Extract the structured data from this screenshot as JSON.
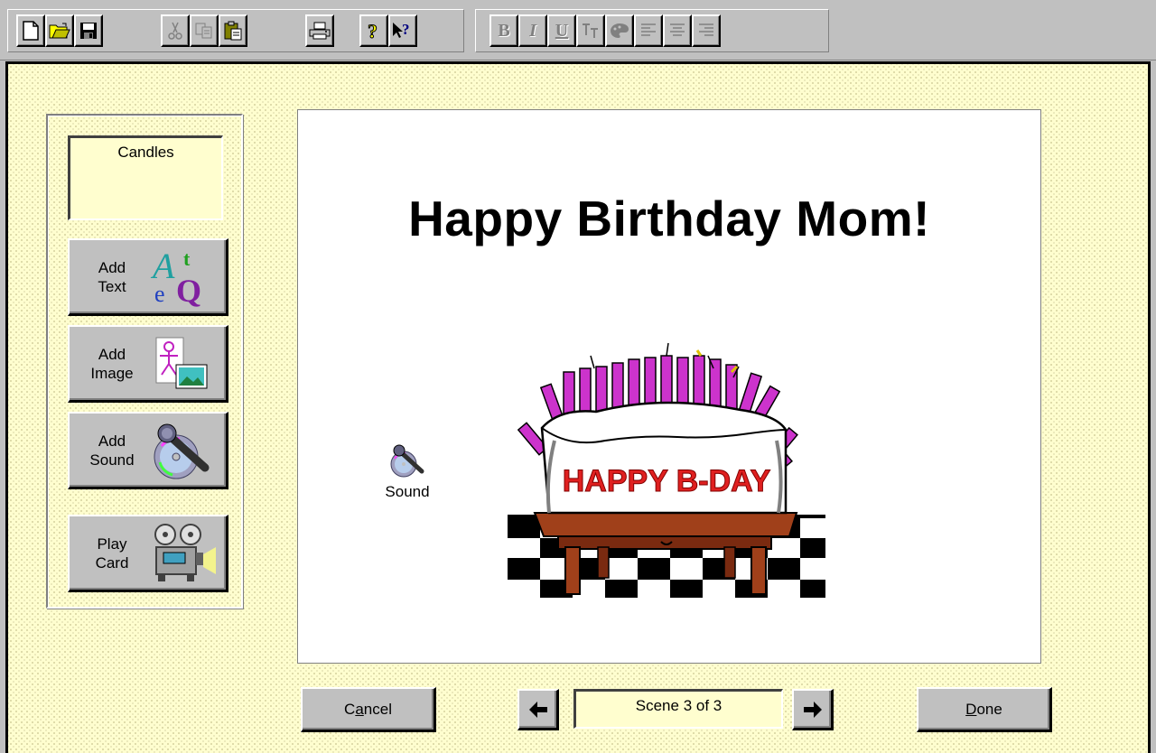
{
  "toolbar": {
    "file_buttons": [
      "new-document-icon",
      "open-folder-icon",
      "save-disk-icon"
    ],
    "edit_buttons": [
      "cut-scissors-icon",
      "copy-icon",
      "paste-icon"
    ],
    "print_button": "printer-icon",
    "help_buttons": [
      "help-question-icon",
      "context-help-icon"
    ],
    "format": {
      "bold": "B",
      "italic": "I",
      "underline": "U"
    }
  },
  "sidebar": {
    "scene_name": "Candles",
    "add_text": {
      "line1": "Add",
      "line2": "Text"
    },
    "add_image": {
      "line1": "Add",
      "line2": "Image"
    },
    "add_sound": {
      "line1": "Add",
      "line2": "Sound"
    },
    "play_card": {
      "line1": "Play",
      "line2": "Card"
    }
  },
  "card": {
    "title": "Happy Birthday Mom!",
    "sound_label": "Sound",
    "banner_text": "HAPPY B-DAY"
  },
  "footer": {
    "cancel_pre": "C",
    "cancel_ul": "a",
    "cancel_post": "ncel",
    "scene_counter": "Scene 3 of 3",
    "done_ul": "D",
    "done_post": "one"
  },
  "colors": {
    "panel_background": "#fffecf",
    "chrome": "#c0c0c0",
    "candles": "#cc33cc",
    "banner_text": "#e02020",
    "table": "#a0401a"
  }
}
